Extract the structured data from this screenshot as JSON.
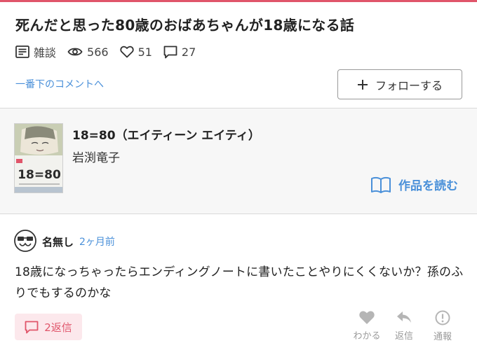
{
  "post": {
    "title": "死んだと思った80歳のおばあちゃんが18歳になる話",
    "category": "雑談",
    "views": "566",
    "likes": "51",
    "comments": "27",
    "jump_link": "一番下のコメントへ",
    "follow_label": "フォローする"
  },
  "work": {
    "title": "18=80（エイティーン エイティ）",
    "author": "岩渕竜子",
    "cover_text": "18=80",
    "read_label": "作品を読む"
  },
  "comment": {
    "user": "名無し",
    "time": "2ヶ月前",
    "body": "18歳になっちゃったらエンディングノートに書いたことやりにくくないか？孫のふりでもするのかな",
    "reply_count_label": "2返信",
    "actions": {
      "like": "わかる",
      "reply": "返信",
      "report": "通報"
    }
  },
  "colors": {
    "accent": "#e0556a",
    "link": "#4a90d9",
    "muted": "#9a9a9a",
    "reply_bg": "#fce8ec",
    "card_bg": "#f7f7f7"
  },
  "icons": {
    "category": "list-document-icon",
    "views": "eye-icon",
    "likes": "heart-outline-icon",
    "comments": "speech-bubble-icon",
    "follow": "plus-icon",
    "read": "open-book-icon",
    "avatar": "glasses-face-icon",
    "reply": "speech-bubble-icon",
    "like_action": "heart-icon",
    "reply_action": "reply-arrow-icon",
    "report_action": "exclamation-circle-icon"
  }
}
